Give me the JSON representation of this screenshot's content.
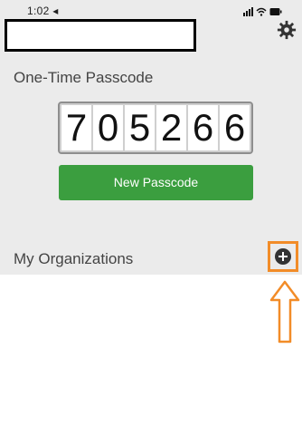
{
  "status_bar": {
    "time": "1:02 ◂",
    "icons": [
      "signal-icon",
      "wifi-icon",
      "battery-icon"
    ]
  },
  "passcode": {
    "title": "One-Time Passcode",
    "digits": [
      "7",
      "0",
      "5",
      "2",
      "6",
      "6"
    ],
    "button_label": "New Passcode"
  },
  "organizations": {
    "title": "My Organizations",
    "add_icon": "plus-circle-icon"
  },
  "colors": {
    "button_green": "#3b9e3f",
    "highlight_orange": "#f28c28",
    "top_background": "#ebebeb"
  }
}
